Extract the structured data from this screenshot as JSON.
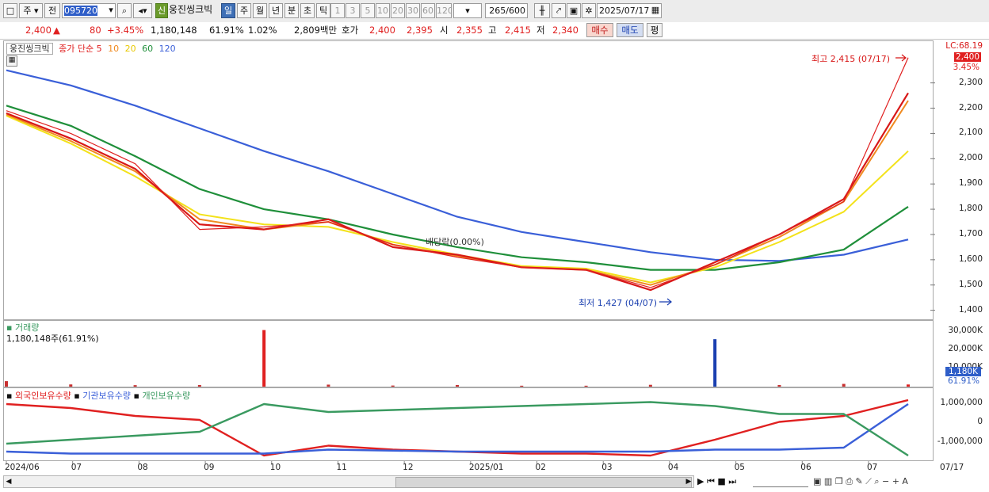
{
  "toolbar": {
    "period_main": "주",
    "range_main": "전",
    "code": "095720",
    "badge_new": "신",
    "stock_name": "웅진씽크빅",
    "periods": [
      "일",
      "주",
      "월",
      "년",
      "분",
      "초",
      "틱"
    ],
    "selected_period": "일",
    "intervals": [
      "1",
      "3",
      "5",
      "10",
      "20",
      "30",
      "60",
      "120"
    ],
    "count_value": "265",
    "count_max": "/600",
    "date": "2025/07/17"
  },
  "quote": {
    "price": "2,400",
    "change_arrow": "▲",
    "change": "80",
    "change_pct": "+3.45%",
    "volume": "1,180,148",
    "volume_ratio": "61.91%",
    "turnover": "1.02%",
    "amount": "2,809백만",
    "ask_label": "호가",
    "ask": "2,400",
    "bid": "2,395",
    "open_label": "시",
    "open": "2,355",
    "high_label": "고",
    "high": "2,415",
    "low_label": "저",
    "low": "2,340",
    "buy_label": "매수",
    "sell_label": "매도",
    "flat_label": "평"
  },
  "price_pane": {
    "name_box": "웅진씽크빅",
    "legend_prefix": "종가 단순",
    "ma_periods": [
      "5",
      "10",
      "20",
      "60",
      "120"
    ],
    "lc_label": "LC:68.19",
    "current_price_tag": "2,400",
    "current_pct_tag": "3.45%",
    "high_note": "최고 2,415 (07/17)",
    "low_note": "최저 1,427 (04/07)",
    "event_note": "배당락(0.00%)",
    "y_ticks": [
      "2,300",
      "2,200",
      "2,100",
      "2,000",
      "1,900",
      "1,800",
      "1,700",
      "1,600",
      "1,500",
      "1,400"
    ]
  },
  "volume_pane": {
    "title": "거래량",
    "value": "1,180,148주(61.91%)",
    "y_ticks": [
      "30,000K",
      "20,000K",
      "10,000K"
    ],
    "tag_value": "1,180K",
    "tag_pct": "61.91%"
  },
  "holdings_pane": {
    "legend": [
      "외국인보유수량",
      "기관보유수량",
      "개인보유수량"
    ],
    "y_ticks": [
      "1,000,000",
      "0",
      "-1,000,000"
    ]
  },
  "x_axis": {
    "labels": [
      "2024/06",
      "07",
      "08",
      "09",
      "10",
      "11",
      "12",
      "2025/01",
      "02",
      "03",
      "04",
      "05",
      "06",
      "07"
    ],
    "last_date": "07/17"
  },
  "colors": {
    "up": "#e02020",
    "down": "#1a3fb0",
    "ma5": "#d81818",
    "ma10": "#f08a20",
    "ma20": "#f3e21a",
    "ma60": "#1f8f3a",
    "ma120": "#3a5fd8",
    "foreign": "#e02020",
    "institution": "#3a5fd8",
    "individual": "#3a9a60"
  },
  "chart_data": [
    {
      "type": "line",
      "title": "웅진씽크빅",
      "x": [
        "2024/06",
        "07",
        "08",
        "09",
        "10",
        "11",
        "12",
        "2025/01",
        "02",
        "03",
        "04",
        "05",
        "06",
        "07",
        "07/17"
      ],
      "series": [
        {
          "name": "종가",
          "values": [
            2190,
            2100,
            1980,
            1720,
            1730,
            1750,
            1660,
            1610,
            1570,
            1560,
            1490,
            1580,
            1700,
            1830,
            2400
          ]
        },
        {
          "name": "5",
          "values": [
            2180,
            2080,
            1960,
            1740,
            1720,
            1760,
            1650,
            1620,
            1570,
            1560,
            1480,
            1590,
            1700,
            1840,
            2260
          ]
        },
        {
          "name": "10",
          "values": [
            2175,
            2070,
            1950,
            1760,
            1720,
            1750,
            1660,
            1615,
            1570,
            1560,
            1500,
            1580,
            1690,
            1830,
            2230
          ]
        },
        {
          "name": "20",
          "values": [
            2170,
            2060,
            1930,
            1780,
            1740,
            1730,
            1670,
            1620,
            1575,
            1565,
            1510,
            1570,
            1670,
            1790,
            2030
          ]
        },
        {
          "name": "60",
          "values": [
            2210,
            2130,
            2010,
            1880,
            1800,
            1760,
            1700,
            1650,
            1610,
            1590,
            1560,
            1560,
            1590,
            1640,
            1810
          ]
        },
        {
          "name": "120",
          "values": [
            2350,
            2290,
            2210,
            2120,
            2030,
            1950,
            1860,
            1770,
            1710,
            1670,
            1630,
            1600,
            1595,
            1620,
            1680
          ]
        }
      ],
      "ylim": [
        1380,
        2440
      ]
    },
    {
      "type": "bar",
      "title": "거래량",
      "x": [
        "2024/06",
        "07",
        "08",
        "09",
        "10",
        "11",
        "12",
        "2025/01",
        "02",
        "03",
        "04",
        "05",
        "06",
        "07",
        "07/17"
      ],
      "series": [
        {
          "name": "거래량",
          "values": [
            3000,
            1200,
            800,
            900,
            31000,
            1100,
            600,
            900,
            500,
            500,
            1000,
            26000,
            900,
            1500,
            1180
          ]
        }
      ],
      "ylim": [
        0,
        33000
      ]
    },
    {
      "type": "line",
      "x": [
        "2024/06",
        "07",
        "08",
        "09",
        "10",
        "11",
        "12",
        "2025/01",
        "02",
        "03",
        "04",
        "05",
        "06",
        "07",
        "07/17"
      ],
      "series": [
        {
          "name": "외국인보유수량",
          "values": [
            900000,
            700000,
            300000,
            100000,
            -1700000,
            -1200000,
            -1400000,
            -1500000,
            -1600000,
            -1600000,
            -1700000,
            -900000,
            0,
            300000,
            1100000
          ]
        },
        {
          "name": "기관보유수량",
          "values": [
            -1500000,
            -1600000,
            -1600000,
            -1600000,
            -1600000,
            -1400000,
            -1450000,
            -1500000,
            -1500000,
            -1500000,
            -1500000,
            -1400000,
            -1400000,
            -1300000,
            900000
          ]
        },
        {
          "name": "개인보유수량",
          "values": [
            -1100000,
            -900000,
            -700000,
            -500000,
            900000,
            500000,
            600000,
            700000,
            800000,
            900000,
            1000000,
            800000,
            400000,
            400000,
            -1700000
          ]
        }
      ],
      "ylim": [
        -1900000,
        1300000
      ]
    }
  ]
}
